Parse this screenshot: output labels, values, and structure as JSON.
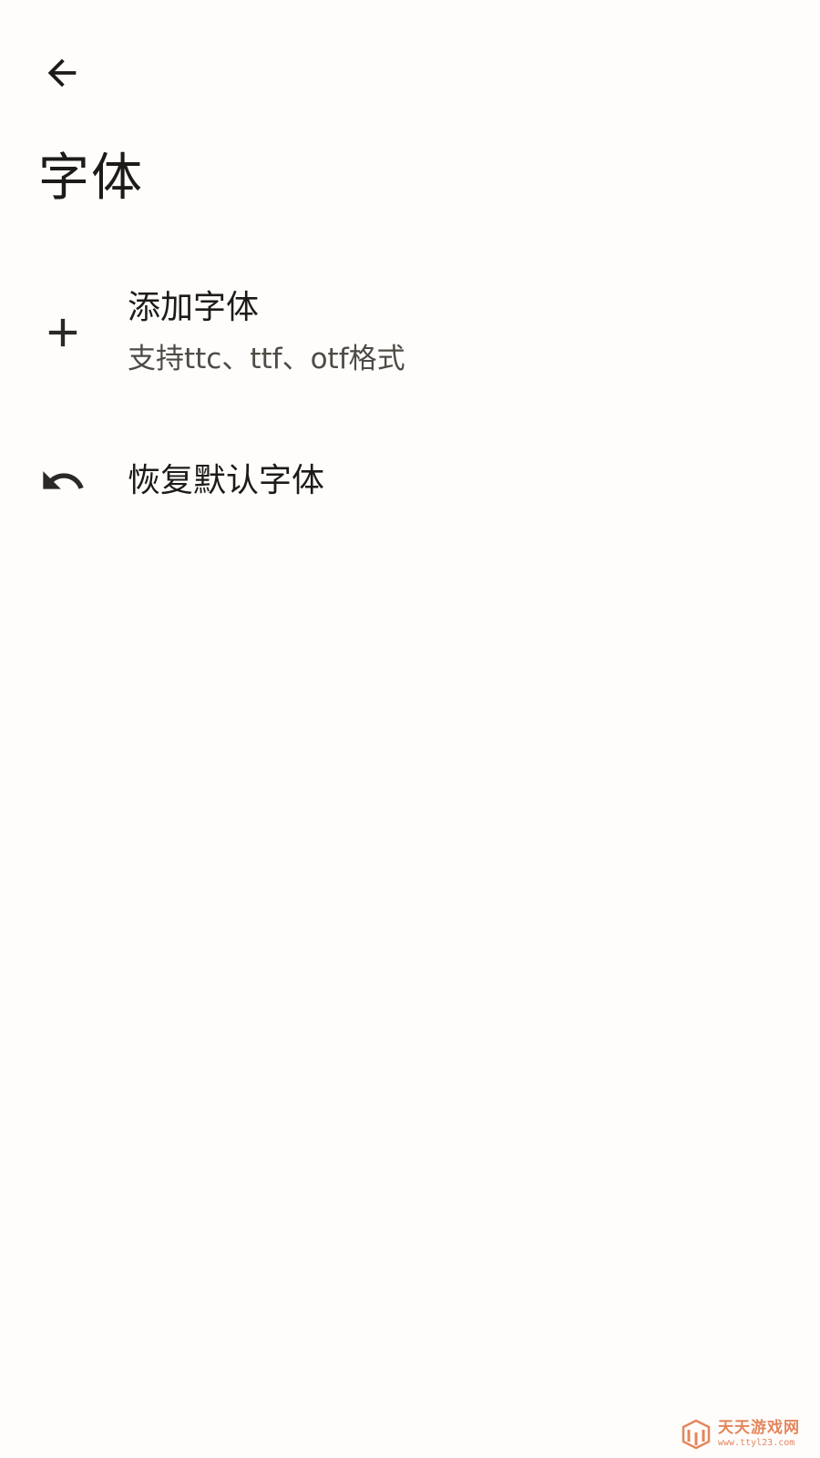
{
  "header": {
    "back_icon": "arrow-left-icon",
    "title": "字体"
  },
  "items": [
    {
      "icon": "plus-icon",
      "title": "添加字体",
      "subtitle": "支持ttc、ttf、otf格式"
    },
    {
      "icon": "undo-icon",
      "title": "恢复默认字体"
    }
  ],
  "watermark": {
    "name": "天天游戏网",
    "url": "www.ttyl23.com"
  },
  "colors": {
    "background": "#fffdfb",
    "text_primary": "#1c1b1a",
    "text_secondary": "#4f4a45",
    "icon": "#2b2926",
    "watermark": "#e07a4c"
  }
}
